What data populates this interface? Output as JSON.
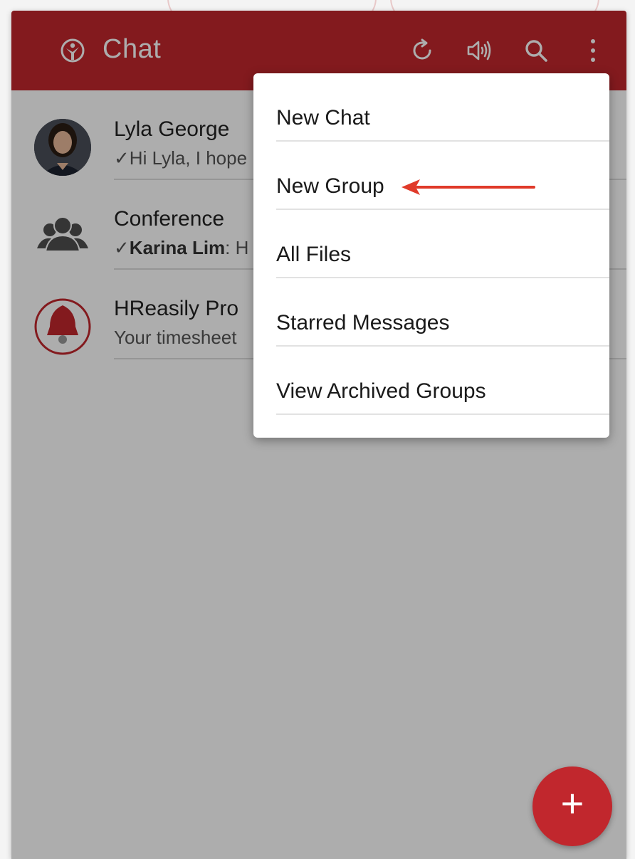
{
  "header": {
    "title": "Chat",
    "logo_icon": "hreasily-logo-icon",
    "actions": [
      "refresh-icon",
      "speaker-icon",
      "search-icon",
      "more-vertical-icon"
    ]
  },
  "chats": [
    {
      "name": "Lyla George",
      "preview_prefix": "",
      "preview_text": "Hi Lyla, I hope",
      "read": true,
      "avatar": "photo-avatar"
    },
    {
      "name": "Conference",
      "preview_prefix": "Karina Lim",
      "preview_text": ": H",
      "read": true,
      "avatar": "group-icon"
    },
    {
      "name": "HReasily Pro",
      "preview_prefix": "",
      "preview_text": "Your timesheet",
      "read": false,
      "avatar": "bell-icon"
    }
  ],
  "menu": {
    "items": [
      "New Chat",
      "New Group",
      "All Files",
      "Starred Messages",
      "View Archived Groups"
    ],
    "highlighted": "New Group"
  },
  "colors": {
    "brand": "#c1272d",
    "arrow": "#e03a2a"
  },
  "fab": {
    "icon": "plus-icon"
  }
}
